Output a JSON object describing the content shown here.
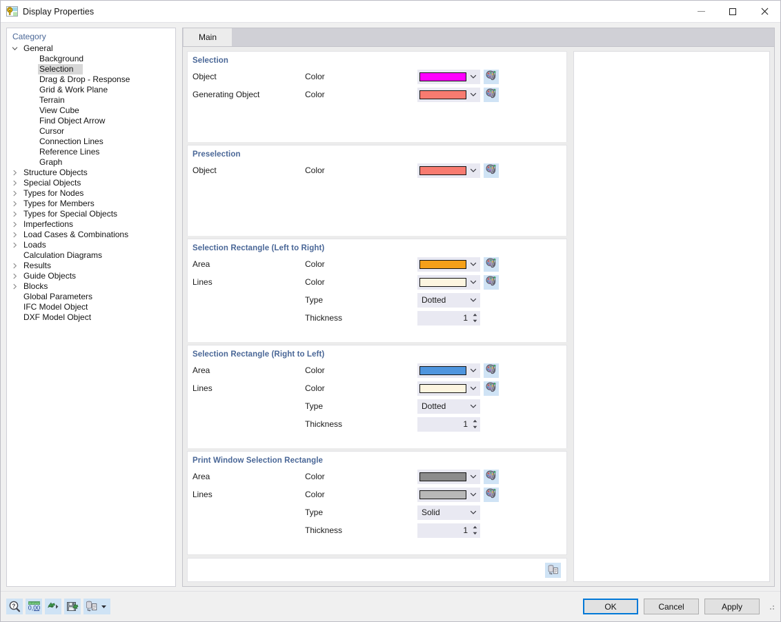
{
  "window": {
    "title": "Display Properties",
    "icon": "display-properties-icon",
    "controls": {
      "minimize": "minimize-icon",
      "maximize": "maximize-icon",
      "close": "close-icon"
    }
  },
  "tree": {
    "header": "Category",
    "items": [
      {
        "label": "General",
        "level": 1,
        "expanded": true,
        "chevron": "chevron-down-icon",
        "selected": false
      },
      {
        "label": "Background",
        "level": 2,
        "chevron": "",
        "selected": false
      },
      {
        "label": "Selection",
        "level": 2,
        "chevron": "",
        "selected": true
      },
      {
        "label": "Drag & Drop - Response",
        "level": 2,
        "chevron": "",
        "selected": false
      },
      {
        "label": "Grid & Work Plane",
        "level": 2,
        "chevron": "",
        "selected": false
      },
      {
        "label": "Terrain",
        "level": 2,
        "chevron": "",
        "selected": false
      },
      {
        "label": "View Cube",
        "level": 2,
        "chevron": "",
        "selected": false
      },
      {
        "label": "Find Object Arrow",
        "level": 2,
        "chevron": "",
        "selected": false
      },
      {
        "label": "Cursor",
        "level": 2,
        "chevron": "",
        "selected": false
      },
      {
        "label": "Connection Lines",
        "level": 2,
        "chevron": "",
        "selected": false
      },
      {
        "label": "Reference Lines",
        "level": 2,
        "chevron": "",
        "selected": false
      },
      {
        "label": "Graph",
        "level": 2,
        "chevron": "",
        "selected": false
      },
      {
        "label": "Structure Objects",
        "level": 1,
        "expanded": false,
        "chevron": "chevron-right-icon",
        "selected": false
      },
      {
        "label": "Special Objects",
        "level": 1,
        "expanded": false,
        "chevron": "chevron-right-icon",
        "selected": false
      },
      {
        "label": "Types for Nodes",
        "level": 1,
        "expanded": false,
        "chevron": "chevron-right-icon",
        "selected": false
      },
      {
        "label": "Types for Members",
        "level": 1,
        "expanded": false,
        "chevron": "chevron-right-icon",
        "selected": false
      },
      {
        "label": "Types for Special Objects",
        "level": 1,
        "expanded": false,
        "chevron": "chevron-right-icon",
        "selected": false
      },
      {
        "label": "Imperfections",
        "level": 1,
        "expanded": false,
        "chevron": "chevron-right-icon",
        "selected": false
      },
      {
        "label": "Load Cases & Combinations",
        "level": 1,
        "expanded": false,
        "chevron": "chevron-right-icon",
        "selected": false
      },
      {
        "label": "Loads",
        "level": 1,
        "expanded": false,
        "chevron": "chevron-right-icon",
        "selected": false
      },
      {
        "label": "Calculation Diagrams",
        "level": 1,
        "expanded": false,
        "chevron": "",
        "selected": false
      },
      {
        "label": "Results",
        "level": 1,
        "expanded": false,
        "chevron": "chevron-right-icon",
        "selected": false
      },
      {
        "label": "Guide Objects",
        "level": 1,
        "expanded": false,
        "chevron": "chevron-right-icon",
        "selected": false
      },
      {
        "label": "Blocks",
        "level": 1,
        "expanded": false,
        "chevron": "chevron-right-icon",
        "selected": false
      },
      {
        "label": "Global Parameters",
        "level": 1,
        "expanded": false,
        "chevron": "",
        "selected": false
      },
      {
        "label": "IFC Model Object",
        "level": 1,
        "expanded": false,
        "chevron": "",
        "selected": false
      },
      {
        "label": "DXF Model Object",
        "level": 1,
        "expanded": false,
        "chevron": "",
        "selected": false
      }
    ]
  },
  "tabs": [
    {
      "label": "Main",
      "active": true
    }
  ],
  "groups": [
    {
      "title": "Selection",
      "rows": [
        {
          "name": "Object",
          "prop": "Color",
          "control": "color",
          "color": "#ff00ff",
          "palette": "color-palette-icon"
        },
        {
          "name": "Generating Object",
          "prop": "Color",
          "control": "color",
          "color": "#f87b70",
          "palette": "color-palette-icon"
        }
      ]
    },
    {
      "title": "Preselection",
      "rows": [
        {
          "name": "Object",
          "prop": "Color",
          "control": "color",
          "color": "#f87b70",
          "palette": "color-palette-icon"
        }
      ]
    },
    {
      "title": "Selection Rectangle (Left to Right)",
      "rows": [
        {
          "name": "Area",
          "prop": "Color",
          "control": "color",
          "color": "#f6a019",
          "palette": "color-palette-icon"
        },
        {
          "name": "Lines",
          "prop": "Color",
          "control": "color",
          "color": "#fdf5e0",
          "palette": "color-palette-icon"
        },
        {
          "name": "",
          "prop": "Type",
          "control": "select",
          "value": "Dotted"
        },
        {
          "name": "",
          "prop": "Thickness",
          "control": "spin",
          "value": "1"
        }
      ]
    },
    {
      "title": "Selection Rectangle (Right to Left)",
      "rows": [
        {
          "name": "Area",
          "prop": "Color",
          "control": "color",
          "color": "#4e95de",
          "palette": "color-palette-icon"
        },
        {
          "name": "Lines",
          "prop": "Color",
          "control": "color",
          "color": "#fdf5e0",
          "palette": "color-palette-icon"
        },
        {
          "name": "",
          "prop": "Type",
          "control": "select",
          "value": "Dotted"
        },
        {
          "name": "",
          "prop": "Thickness",
          "control": "spin",
          "value": "1"
        }
      ]
    },
    {
      "title": "Print Window Selection Rectangle",
      "rows": [
        {
          "name": "Area",
          "prop": "Color",
          "control": "color",
          "color": "#8c8c8c",
          "palette": "color-palette-icon"
        },
        {
          "name": "Lines",
          "prop": "Color",
          "control": "color",
          "color": "#b8b8b8",
          "palette": "color-palette-icon"
        },
        {
          "name": "",
          "prop": "Type",
          "control": "select",
          "value": "Solid"
        },
        {
          "name": "",
          "prop": "Thickness",
          "control": "spin",
          "value": "1"
        }
      ]
    }
  ],
  "footer": {
    "db_button": "save-to-database-icon"
  },
  "toolbar": [
    {
      "icon": "help-magnifier-icon"
    },
    {
      "icon": "decimal-places-icon",
      "label": "0,00"
    },
    {
      "icon": "import-icon"
    },
    {
      "icon": "save-icon"
    },
    {
      "icon": "database-list-icon",
      "caret": "caret-down-icon"
    }
  ],
  "buttons": {
    "ok": "OK",
    "cancel": "Cancel",
    "apply": "Apply"
  }
}
